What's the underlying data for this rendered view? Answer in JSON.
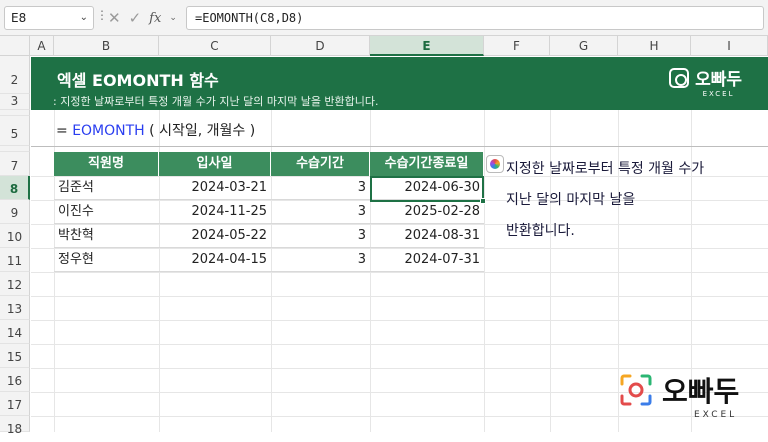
{
  "name_box": "E8",
  "formula": "=EOMONTH(C8,D8)",
  "columns": [
    "A",
    "B",
    "C",
    "D",
    "E",
    "F",
    "G",
    "H",
    "I"
  ],
  "selected_column": "E",
  "rows": [
    "2",
    "3",
    "",
    "5",
    "",
    "7",
    "8",
    "9",
    "10",
    "11",
    "12",
    "13",
    "14",
    "15",
    "16",
    "17",
    "18"
  ],
  "selected_row": "8",
  "banner": {
    "title": "엑셀 EOMONTH 함수",
    "subtitle": ": 지정한 날짜로부터 특정 개월 수가 지난 달의 마지막 날을 반환합니다.",
    "brand_name": "오빠두",
    "brand_sub": "EXCEL"
  },
  "syntax": {
    "prefix": "=",
    "function": "EOMONTH",
    "args": "( 시작일, 개월수 )"
  },
  "table": {
    "headers": [
      "직원명",
      "입사일",
      "수습기간",
      "수습기간종료일"
    ],
    "rows": [
      [
        "김준석",
        "2024-03-21",
        "3",
        "2024-06-30"
      ],
      [
        "이진수",
        "2024-11-25",
        "3",
        "2025-02-28"
      ],
      [
        "박찬혁",
        "2024-05-22",
        "3",
        "2024-08-31"
      ],
      [
        "정우현",
        "2024-04-15",
        "3",
        "2024-07-31"
      ]
    ]
  },
  "note": [
    "지정한 날짜로부터 특정 개월 수가",
    "지난 달의 마지막 날을",
    "반환합니다."
  ],
  "brand": {
    "name": "오빠두",
    "sub": "EXCEL"
  },
  "colors": {
    "excel_green": "#1e7145",
    "header_green": "#3c8d5e",
    "function_blue": "#2a3ef0"
  }
}
